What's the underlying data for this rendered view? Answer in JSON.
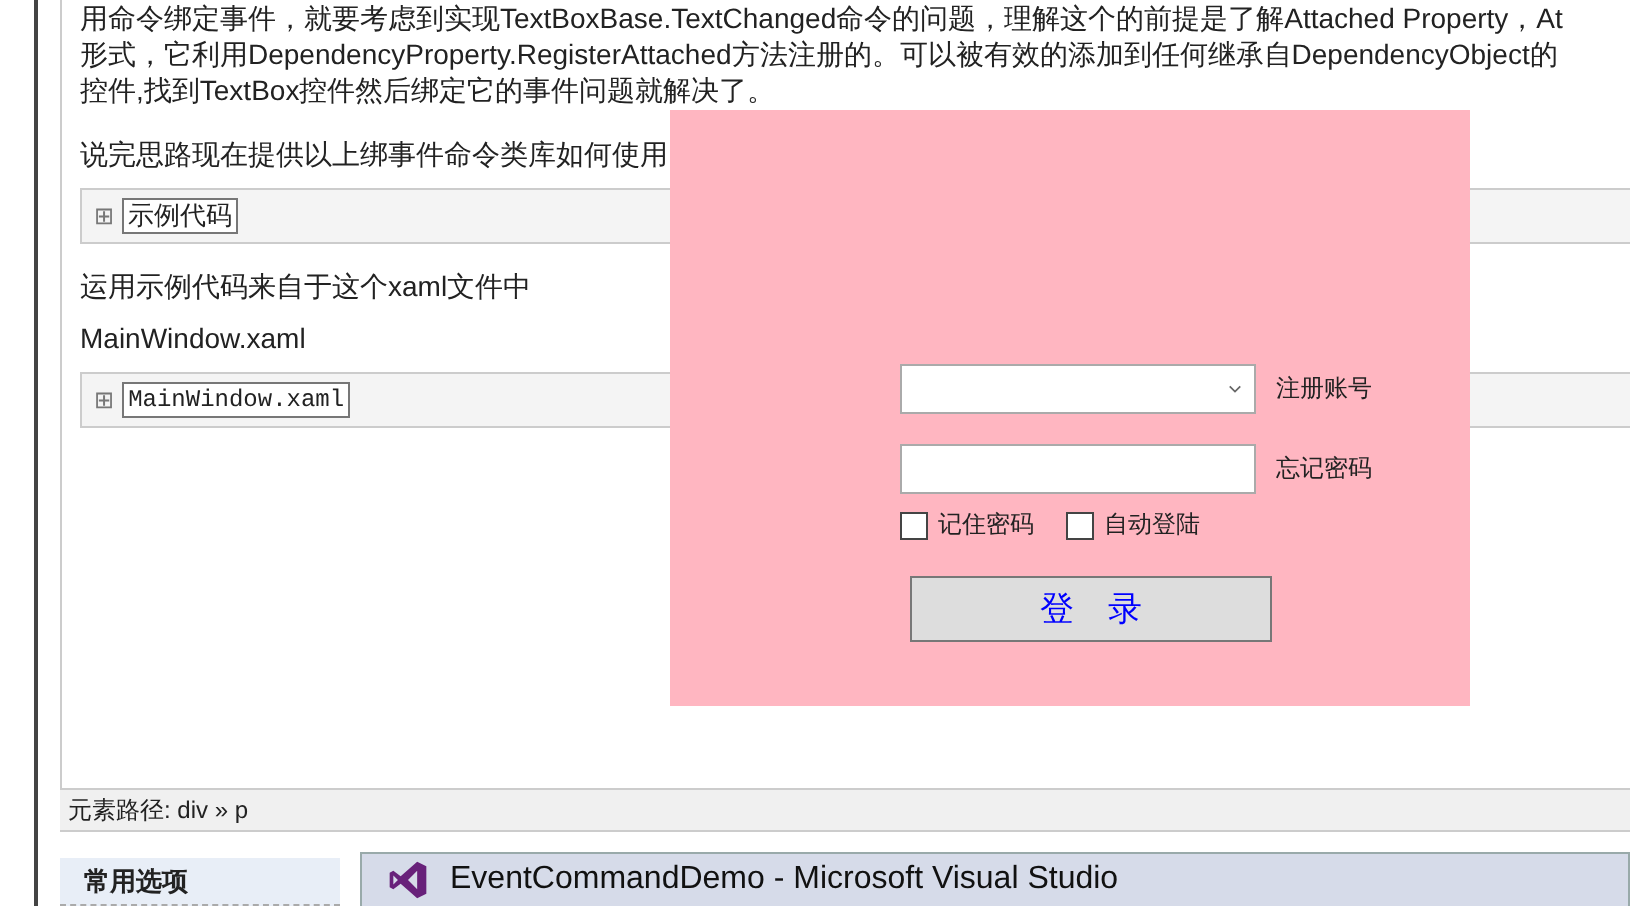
{
  "article": {
    "paragraphs": [
      {
        "kind": "text",
        "text": "用命令绑定事件，就要考虑到实现TextBoxBase.TextChanged命令的问题，理解这个的前提是了解Attached Property，At"
      },
      {
        "kind": "text",
        "text": "形式，它利用DependencyProperty.RegisterAttached方法注册的。可以被有效的添加到任何继承自DependencyObject的"
      },
      {
        "kind": "text",
        "text": "控件,找到TextBox控件然后绑定它的事件问题就解决了。"
      },
      {
        "kind": "gap"
      },
      {
        "kind": "text",
        "text": "说完思路现在提供以上绑事件命令类库如何使用"
      },
      {
        "kind": "code",
        "toggle": "⊞",
        "label": "示例代码",
        "mono": false
      },
      {
        "kind": "text",
        "text": "运用示例代码来自于这个xaml文件中"
      },
      {
        "kind": "text",
        "text": "MainWindow.xaml"
      },
      {
        "kind": "code",
        "toggle": "⊞",
        "label": "MainWindow.xaml",
        "mono": true
      }
    ]
  },
  "status_bar": {
    "path": "元素路径: div » p"
  },
  "options_tab": {
    "label": "常用选项"
  },
  "taskbar_preview": {
    "title": "EventCommandDemo - Microsoft Visual Studio"
  },
  "login_window": {
    "account": {
      "label": "注册账号"
    },
    "password": {
      "label": "忘记密码"
    },
    "checkboxes": [
      {
        "label": "记住密码",
        "checked": false
      },
      {
        "label": "自动登陆",
        "checked": false
      }
    ],
    "login_button": "登　录"
  }
}
